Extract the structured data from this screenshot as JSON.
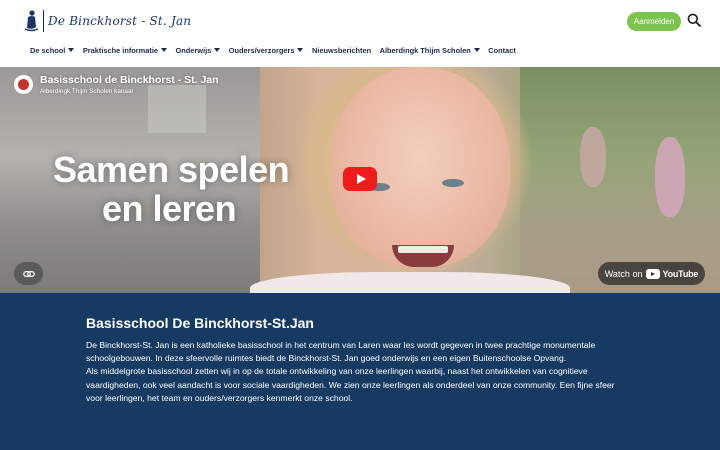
{
  "header": {
    "logo_text": "De Binckhorst - St. Jan",
    "login_label": "Aanmelden",
    "search_icon": "search-icon",
    "colors": {
      "login": "#7cc44f",
      "brand": "#1b3564"
    }
  },
  "nav": {
    "items": [
      {
        "label": "De school",
        "dropdown": true
      },
      {
        "label": "Praktische informatie",
        "dropdown": true
      },
      {
        "label": "Onderwijs",
        "dropdown": true
      },
      {
        "label": "Ouders/verzorgers",
        "dropdown": true
      },
      {
        "label": "Nieuwsberichten",
        "dropdown": false
      },
      {
        "label": "Alberdingk Thijm Scholen",
        "dropdown": true
      },
      {
        "label": "Contact",
        "dropdown": false
      }
    ]
  },
  "video": {
    "title": "Basisschool de Binckhorst - St. Jan",
    "channel": "Alberdingk Thijm Scholen kanaal",
    "overlay_line1": "Samen spelen",
    "overlay_line2": "en leren",
    "watch_prefix": "Watch on",
    "watch_brand": "YouTube",
    "play_color": "#ee1c1b"
  },
  "info": {
    "title": "Basisschool De Binckhorst-St.Jan",
    "paragraph1": "De Binckhorst-St. Jan is een katholieke basisschool in het centrum van Laren waar les wordt gegeven in twee prachtige monumentale schoolgebouwen. In deze sfeervolle ruimtes biedt de Binckhorst-St. Jan goed onderwijs en een eigen Buitenschoolse Opvang.",
    "paragraph2": "Als middelgrote basisschool zetten wij in op de totale ontwikkeling van onze leerlingen waarbij, naast het ontwikkelen van cognitieve vaardigheden, ook veel aandacht is voor sociale vaardigheden. We zien onze leerlingen als onderdeel van onze community. Een fijne sfeer voor leerlingen, het team en ouders/verzorgers kenmerkt onze school.",
    "background": "#173a63"
  }
}
